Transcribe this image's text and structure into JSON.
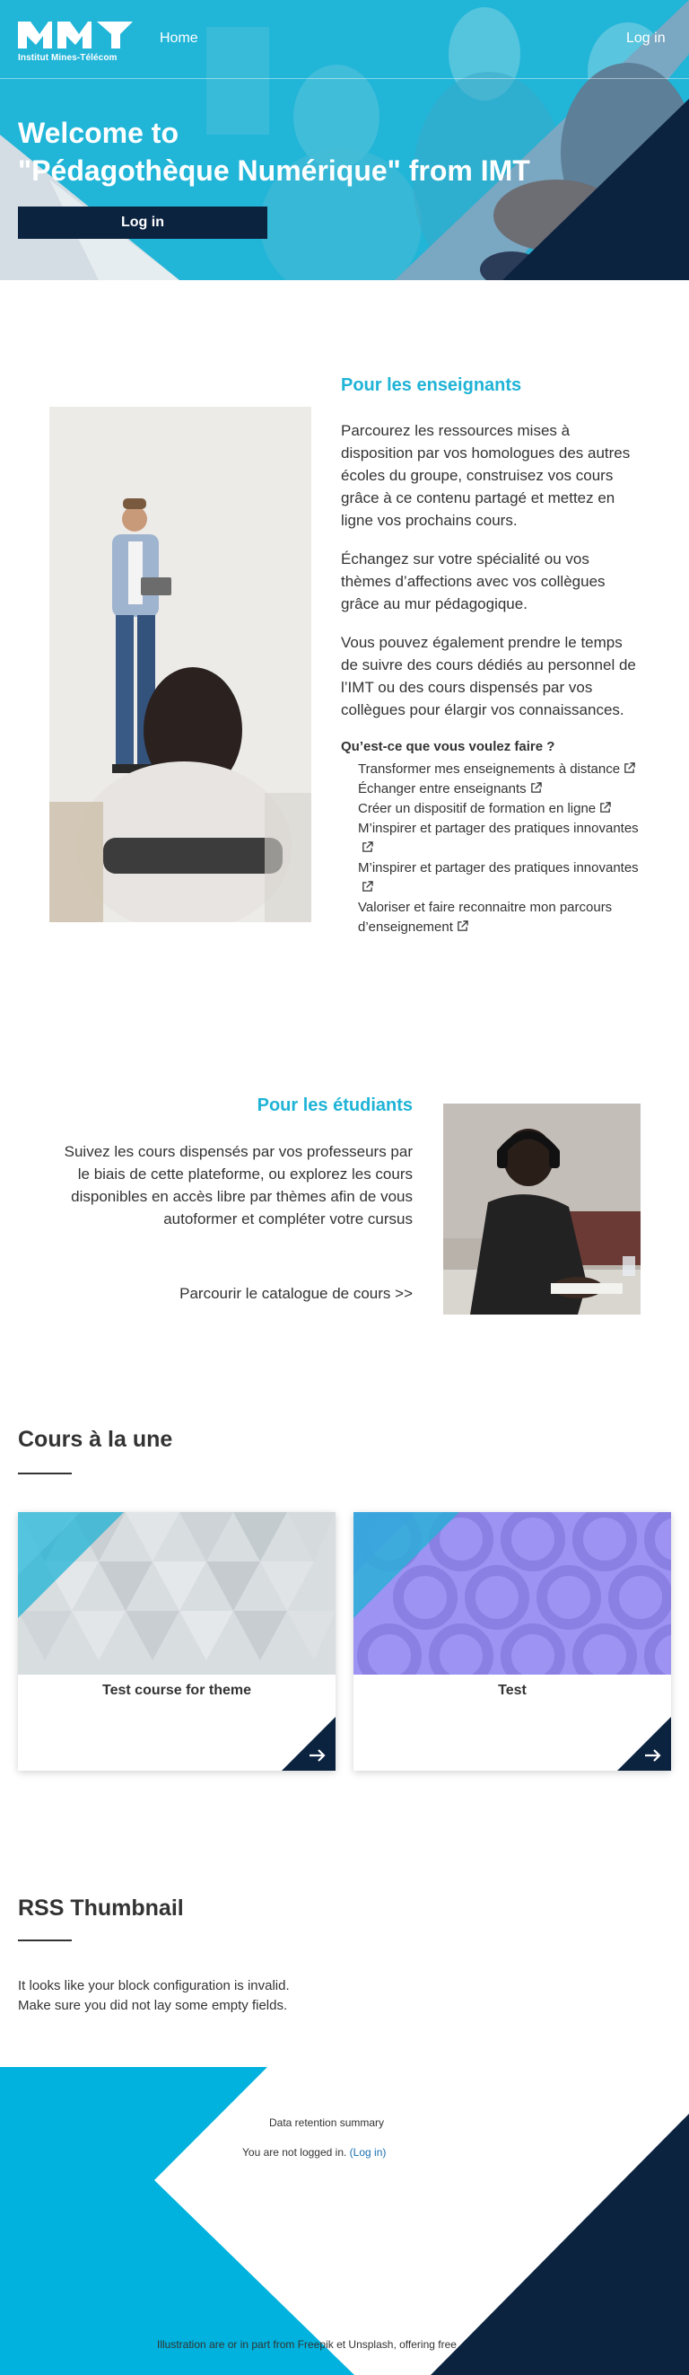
{
  "header": {
    "logo_text": "Institut Mines-Télécom",
    "nav_home": "Home",
    "nav_login": "Log in"
  },
  "hero": {
    "title_line1": "Welcome to",
    "title_line2": "\"Pédagothèque Numérique\" from IMT",
    "login_button": "Log in"
  },
  "teachers": {
    "title": "Pour les enseignants",
    "paragraph1": "Parcourez les ressources mises à disposition par vos homologues des autres écoles du groupe, construisez vos cours grâce à ce contenu partagé et mettez en ligne vos prochains cours.",
    "paragraph2": "Échangez sur votre spécialité ou vos thèmes d’affections avec vos collègues grâce au mur pédagogique.",
    "paragraph3": "Vous pouvez également prendre le temps de suivre des cours dédiés au personnel de l’IMT ou des cours dispensés par vos collègues pour élargir vos connaissances.",
    "question": "Qu’est-ce que vous voulez faire ?",
    "links": [
      "Transformer mes enseignements à distance",
      "Échanger entre enseignants",
      "Créer un dispositif de formation en ligne",
      "M’inspirer et partager des pratiques innovantes",
      "M’inspirer et partager des pratiques innovantes",
      "Valoriser et faire reconnaitre mon parcours d’enseignement"
    ]
  },
  "students": {
    "title": "Pour les étudiants",
    "paragraph": "Suivez les cours dispensés par vos professeurs par le biais de cette plateforme, ou explorez les cours disponibles en accès libre par thèmes afin de vous autoformer et compléter votre cursus",
    "catalogue_link": "Parcourir le catalogue de cours >>"
  },
  "courses": {
    "title": "Cours à la une",
    "items": [
      {
        "name": "Test course for theme"
      },
      {
        "name": "Test"
      }
    ]
  },
  "rss": {
    "title": "RSS Thumbnail",
    "message_line1": "It looks like your block configuration is invalid.",
    "message_line2": "Make sure you did not lay some empty fields."
  },
  "footer": {
    "data_retention": "Data retention summary",
    "not_logged_in": "You are not logged in.",
    "login_link": "(Log in)",
    "credits": "Illustration are or in part from Freepik et Unsplash, offering free"
  },
  "colors": {
    "accent_cyan": "#1fb3d6",
    "navy": "#0c2340"
  },
  "icons": [
    "imt-logo",
    "external-link-icon",
    "arrow-right-icon"
  ]
}
